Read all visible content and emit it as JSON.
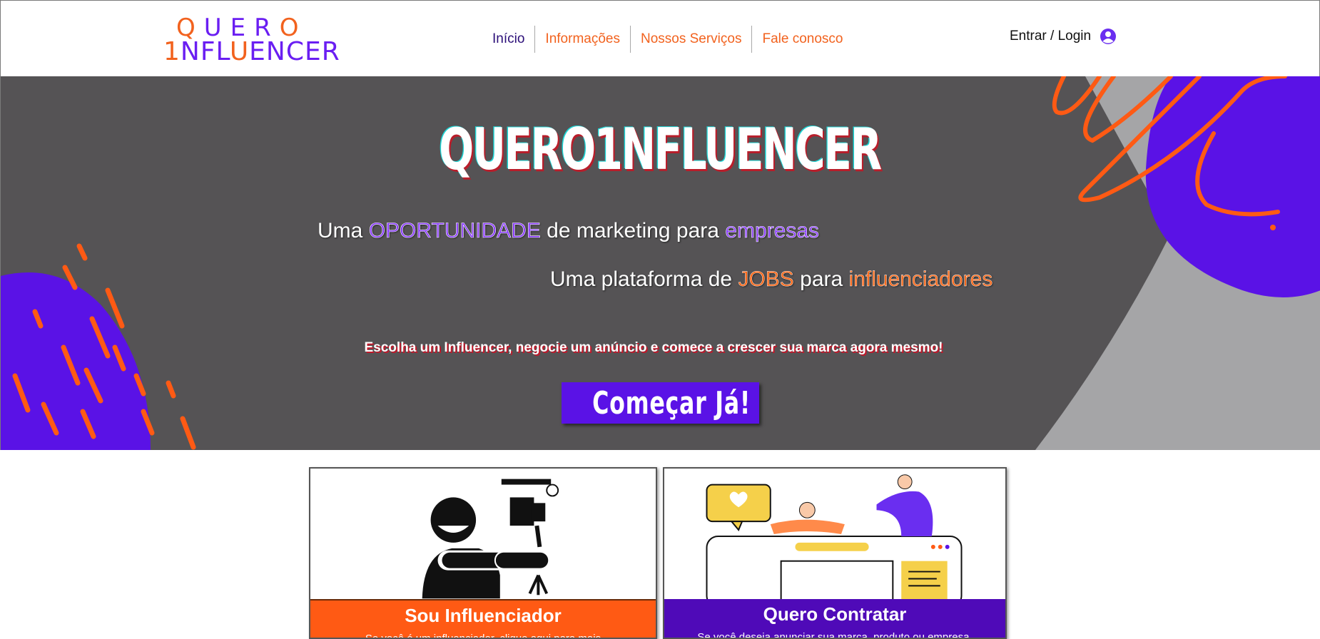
{
  "header": {
    "logo": {
      "line1_prefix": "Q",
      "line1_rest": "UER",
      "line1_end": "O",
      "line2_prefix": "1",
      "line2_a": "NFL",
      "line2_u": "U",
      "line2_rest": "ENCER"
    },
    "nav": [
      {
        "label": "Início"
      },
      {
        "label": "Informações"
      },
      {
        "label": "Nossos Serviços"
      },
      {
        "label": "Fale conosco"
      }
    ],
    "login_label": "Entrar / Login",
    "login_icon": "user-avatar-icon"
  },
  "hero": {
    "title": "QUERO1NFLUENCER",
    "tagline1": {
      "a": "Uma ",
      "b": "OPORTUNIDADE",
      "c": " de marketing para ",
      "d": "empresas"
    },
    "tagline2": {
      "a": "Uma plataforma de ",
      "b": "JOBS",
      "c": " para ",
      "d": "influenciadores"
    },
    "subline": "Escolha um Influencer, negocie um anúncio e comece a crescer sua marca agora mesmo!",
    "cta_label": "Começar Já!"
  },
  "cards": [
    {
      "title": "Sou Influenciador",
      "text": "Se você é um influenciador, clique aqui para mais",
      "image": "videographer-illustration"
    },
    {
      "title": "Quero Contratar",
      "text": "Se você deseja anunciar sua marca, produto ou empresa,",
      "image": "social-media-team-illustration"
    }
  ],
  "colors": {
    "purple": "#5a12e6",
    "orange": "#ff5a14",
    "hero_bg": "#555355",
    "nav_active": "#2b0e78"
  }
}
